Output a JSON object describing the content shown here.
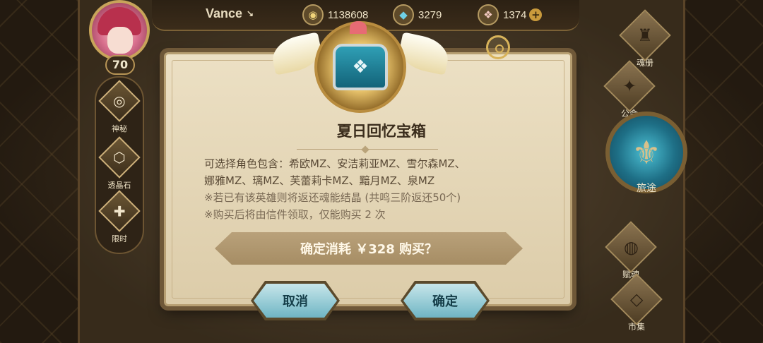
{
  "player": {
    "name": "Vance",
    "level": "70"
  },
  "currencies": [
    {
      "icon": "gold-coin-icon",
      "glyph": "◉",
      "value": "1138608"
    },
    {
      "icon": "crystal-icon",
      "glyph": "◆",
      "value": "3279"
    },
    {
      "icon": "gem-icon",
      "glyph": "❖",
      "value": "1374",
      "has_plus": true
    }
  ],
  "left_menu": [
    {
      "label": "神秘",
      "glyph": "◎",
      "icon": "mystery-icon"
    },
    {
      "label": "透晶石",
      "glyph": "⬡",
      "icon": "crystal-stone-icon"
    },
    {
      "label": "限时",
      "glyph": "✚",
      "icon": "gift-icon"
    }
  ],
  "right_menu": [
    {
      "label": "魂册",
      "glyph": "♜",
      "icon": "soul-book-icon"
    },
    {
      "label": "公会",
      "glyph": "✦",
      "icon": "guild-icon"
    },
    {
      "label": "赋魂",
      "glyph": "◍",
      "icon": "soul-infuse-icon"
    },
    {
      "label": "市集",
      "glyph": "◇",
      "icon": "market-icon"
    }
  ],
  "journey": {
    "label": "旅途",
    "glyph": "⚜"
  },
  "dialog": {
    "title": "夏日回忆宝箱",
    "lines": [
      "可选择角色包含：希欧MZ、安洁莉亚MZ、雪尔森MZ、",
      "娜雅MZ、璃MZ、芙蕾莉卡MZ、黯月MZ、泉MZ"
    ],
    "notes": [
      "※若已有该英雄则将返还魂能结晶 (共鸣三阶返还50个)",
      "※购买后将由信件领取，仅能购买 2 次"
    ],
    "confirm_text": "确定消耗 ￥328 购买？",
    "cancel_label": "取消",
    "ok_label": "确定"
  },
  "colors": {
    "dialog_bg": "#ece0c4",
    "button_teal": "#6fb5c4",
    "gold_trim": "#c8a45a"
  }
}
